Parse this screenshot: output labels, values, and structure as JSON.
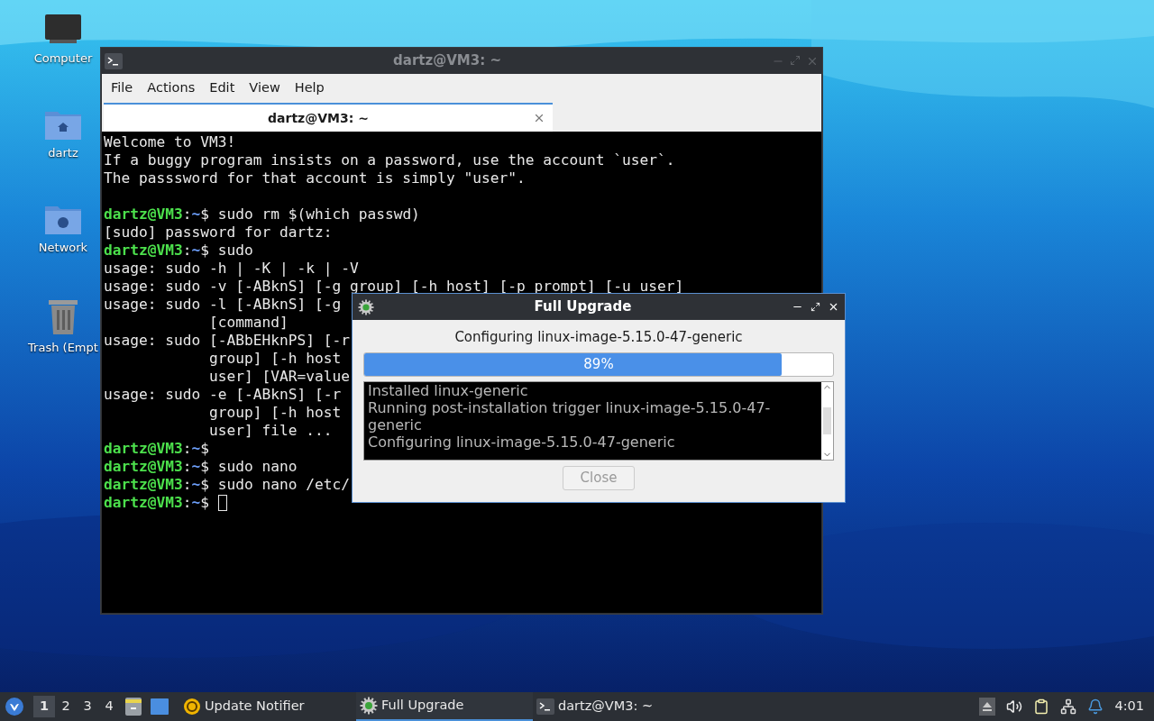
{
  "desktop_icons": [
    {
      "kind": "computer",
      "label": "Computer"
    },
    {
      "kind": "home",
      "label": "dartz"
    },
    {
      "kind": "network",
      "label": "Network"
    },
    {
      "kind": "trash",
      "label": "Trash (Empt"
    }
  ],
  "terminal": {
    "title": "dartz@VM3: ~",
    "menu": [
      "File",
      "Actions",
      "Edit",
      "View",
      "Help"
    ],
    "tabs": [
      {
        "label": "dartz@VM3: ~",
        "selected": true
      }
    ],
    "lines": [
      {
        "kind": "output",
        "text": "Welcome to VM3!"
      },
      {
        "kind": "output",
        "text": "If a buggy program insists on a password, use the account `user`."
      },
      {
        "kind": "output",
        "text": "The passsword for that account is simply \"user\"."
      },
      {
        "kind": "blank"
      },
      {
        "kind": "prompt",
        "user": "dartz@VM3",
        "colon": ":",
        "path": "~",
        "symbol": "$",
        "command": "sudo rm $(which passwd)"
      },
      {
        "kind": "output",
        "text": "[sudo] password for dartz:"
      },
      {
        "kind": "prompt",
        "user": "dartz@VM3",
        "colon": ":",
        "path": "~",
        "symbol": "$",
        "command": "sudo"
      },
      {
        "kind": "output",
        "text": "usage: sudo -h | -K | -k | -V"
      },
      {
        "kind": "output",
        "text": "usage: sudo -v [-ABknS] [-g group] [-h host] [-p prompt] [-u user]"
      },
      {
        "kind": "output",
        "text": "usage: sudo -l [-ABknS] [-g"
      },
      {
        "kind": "output",
        "text": "            [command]"
      },
      {
        "kind": "output",
        "text": "usage: sudo [-ABbEHknPS] [-r"
      },
      {
        "kind": "output",
        "text": "            group] [-h host"
      },
      {
        "kind": "output",
        "text": "            user] [VAR=value"
      },
      {
        "kind": "output",
        "text": "usage: sudo -e [-ABknS] [-r"
      },
      {
        "kind": "output",
        "text": "            group] [-h host"
      },
      {
        "kind": "output",
        "text": "            user] file ..."
      },
      {
        "kind": "prompt",
        "user": "dartz@VM3",
        "colon": ":",
        "path": "~",
        "symbol": "$"
      },
      {
        "kind": "prompt",
        "user": "dartz@VM3",
        "colon": ":",
        "path": "~",
        "symbol": "$",
        "command": "sudo nano"
      },
      {
        "kind": "prompt",
        "user": "dartz@VM3",
        "colon": ":",
        "path": "~",
        "symbol": "$",
        "command": "sudo nano /etc/"
      },
      {
        "kind": "prompt",
        "user": "dartz@VM3",
        "colon": ":",
        "path": "~",
        "symbol": "$",
        "cursor": true
      }
    ]
  },
  "dialog": {
    "title": "Full Upgrade",
    "status": "Configuring linux-image-5.15.0-47-generic",
    "progress": {
      "level": 0.89,
      "label": "89%"
    },
    "log": [
      "Installed linux-generic",
      "Running post-installation trigger linux-image-5.15.0-47-generic",
      "Configuring linux-image-5.15.0-47-generic"
    ],
    "close_button": {
      "label": "Close",
      "disabled": true
    }
  },
  "taskbar": {
    "workspaces": [
      {
        "label": "1",
        "selected": true
      },
      {
        "label": "2",
        "selected": false
      },
      {
        "label": "3",
        "selected": false
      },
      {
        "label": "4",
        "selected": false
      }
    ],
    "tasks": [
      {
        "kind": "notifier",
        "label": "Update Notifier",
        "selected": false
      },
      {
        "kind": "upgrade",
        "label": "Full Upgrade",
        "selected": true
      },
      {
        "kind": "terminal",
        "label": "dartz@VM3: ~",
        "selected": false
      }
    ],
    "clock": "4:01"
  }
}
